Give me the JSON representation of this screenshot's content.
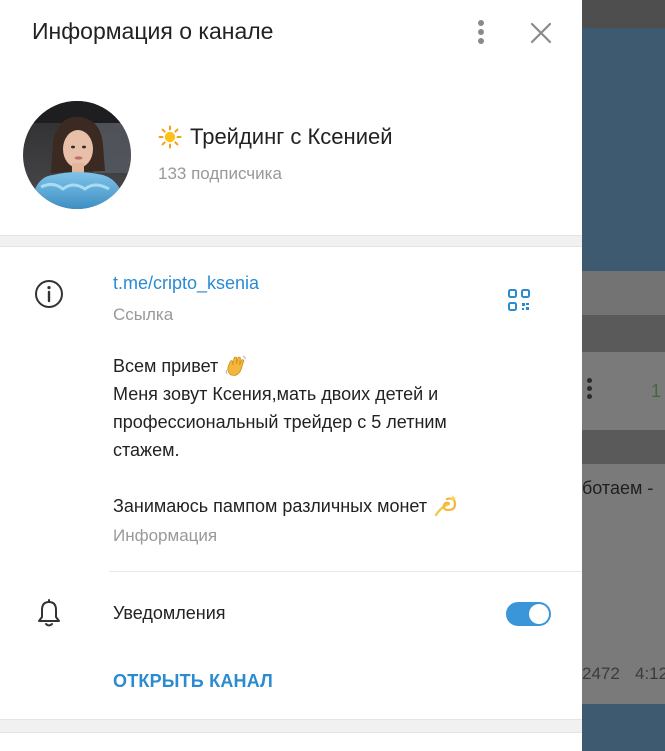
{
  "header": {
    "title": "Информация о канале"
  },
  "channel": {
    "name": "Трейдинг с Ксенией",
    "subscribers": "133 подписчика"
  },
  "info": {
    "link": "t.me/cripto_ksenia",
    "link_label": "Ссылка",
    "description_lines": [
      "Всем привет",
      "Меня зовут Ксения,мать двоих детей и",
      "профессиональный трейдер с 5 летним",
      "стажем.",
      "",
      "Занимаюсь пампом различных монет"
    ],
    "description_label": "Информация"
  },
  "notifications": {
    "label": "Уведомления",
    "enabled": true
  },
  "open_button": {
    "label": "ОТКРЫТЬ КАНАЛ"
  },
  "background_chat": {
    "count": "1",
    "text_fragment": "ботаем -",
    "views": "2472",
    "time": "4:12"
  },
  "colors": {
    "accent": "#2a8bd2",
    "toggle_on": "#3a96d8",
    "background_header": "#3d5a70"
  }
}
